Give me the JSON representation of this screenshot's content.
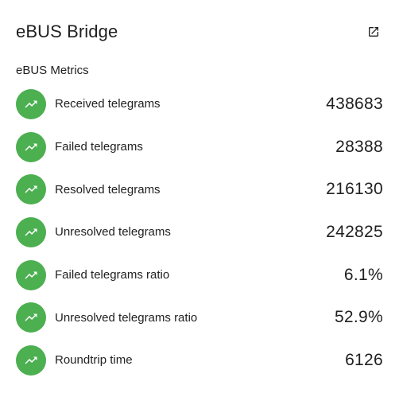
{
  "card": {
    "title": "eBUS Bridge",
    "open_icon": "open-in-new-icon"
  },
  "section": {
    "title": "eBUS Metrics"
  },
  "metrics": [
    {
      "label": "Received telegrams",
      "value": "438683",
      "icon": "trending-up-icon"
    },
    {
      "label": "Failed telegrams",
      "value": "28388",
      "icon": "trending-up-icon"
    },
    {
      "label": "Resolved telegrams",
      "value": "216130",
      "icon": "trending-up-icon"
    },
    {
      "label": "Unresolved telegrams",
      "value": "242825",
      "icon": "trending-up-icon"
    },
    {
      "label": "Failed telegrams ratio",
      "value": "6.1%",
      "icon": "trending-up-icon"
    },
    {
      "label": "Unresolved telegrams ratio",
      "value": "52.9%",
      "icon": "trending-up-icon"
    },
    {
      "label": "Roundtrip time",
      "value": "6126",
      "icon": "trending-up-icon"
    }
  ],
  "colors": {
    "badge": "#4caf50",
    "text": "#212121"
  }
}
